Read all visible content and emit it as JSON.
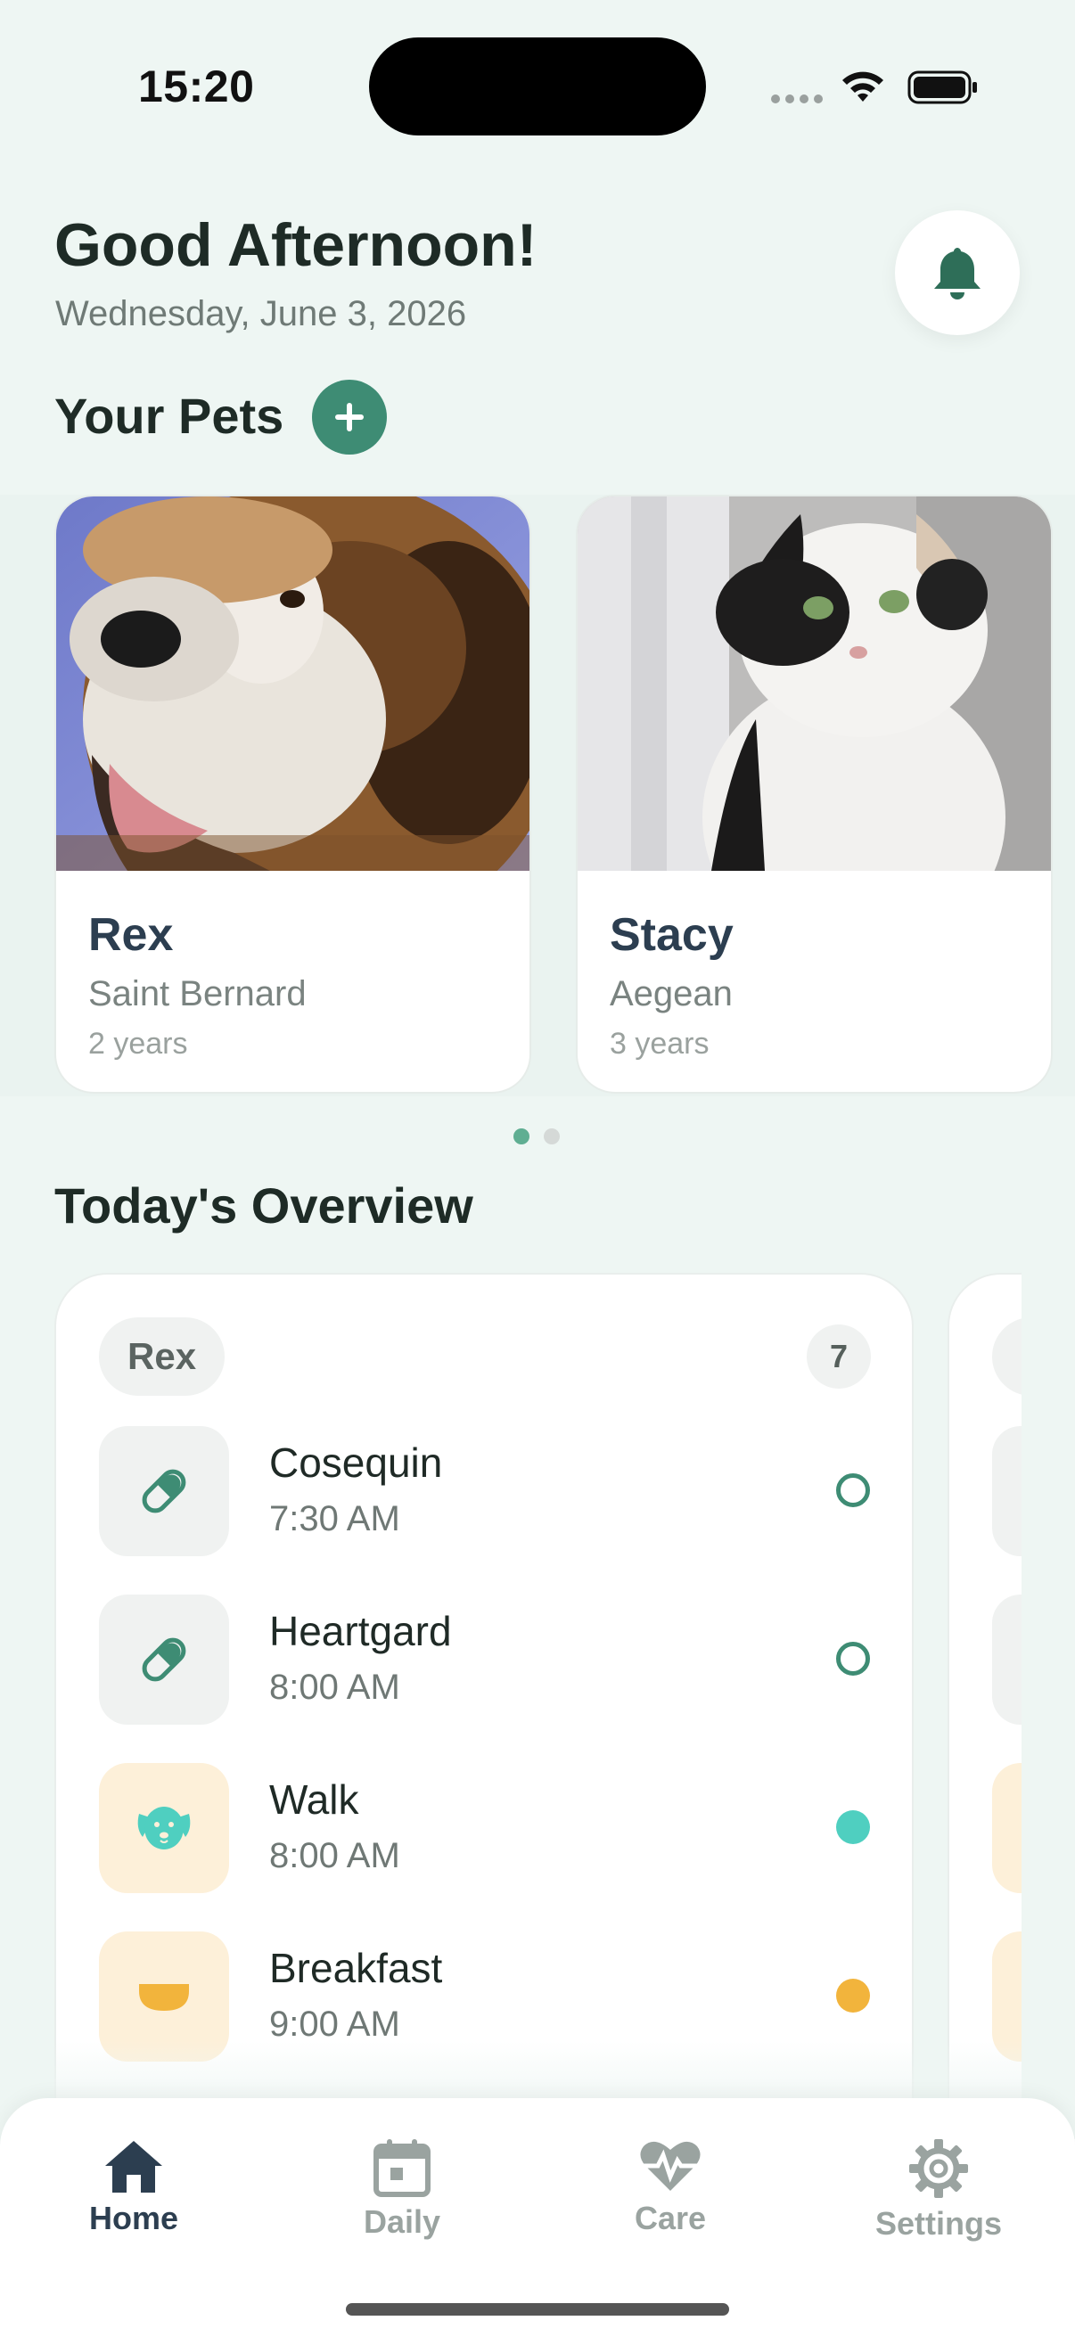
{
  "status_bar": {
    "time": "15:20"
  },
  "header": {
    "greeting": "Good Afternoon!",
    "date": "Wednesday, June 3, 2026"
  },
  "pets_section": {
    "title": "Your Pets",
    "pets": [
      {
        "name": "Rex",
        "breed": "Saint Bernard",
        "age": "2 years"
      },
      {
        "name": "Stacy",
        "breed": "Aegean",
        "age": "3 years"
      }
    ],
    "page_count": 2,
    "active_page": 1
  },
  "overview": {
    "title": "Today's Overview",
    "pet": "Rex",
    "task_count": "7",
    "tasks": [
      {
        "name": "Cosequin",
        "time": "7:30 AM",
        "icon": "pill-icon",
        "status": "pending"
      },
      {
        "name": "Heartgard",
        "time": "8:00 AM",
        "icon": "pill-icon",
        "status": "pending"
      },
      {
        "name": "Walk",
        "time": "8:00 AM",
        "icon": "dog-icon",
        "status": "activity"
      },
      {
        "name": "Breakfast",
        "time": "9:00 AM",
        "icon": "bowl-icon",
        "status": "meal"
      }
    ]
  },
  "tabbar": {
    "tabs": [
      {
        "label": "Home",
        "icon": "home-icon",
        "active": true
      },
      {
        "label": "Daily",
        "icon": "calendar-icon",
        "active": false
      },
      {
        "label": "Care",
        "icon": "heart-pulse-icon",
        "active": false
      },
      {
        "label": "Settings",
        "icon": "gear-icon",
        "active": false
      }
    ]
  },
  "colors": {
    "accent": "#3e8c74",
    "teal": "#4fcfc0",
    "amber": "#f2b43c",
    "tab_active": "#2c3e50",
    "tab_inactive": "#9aa3a0"
  }
}
